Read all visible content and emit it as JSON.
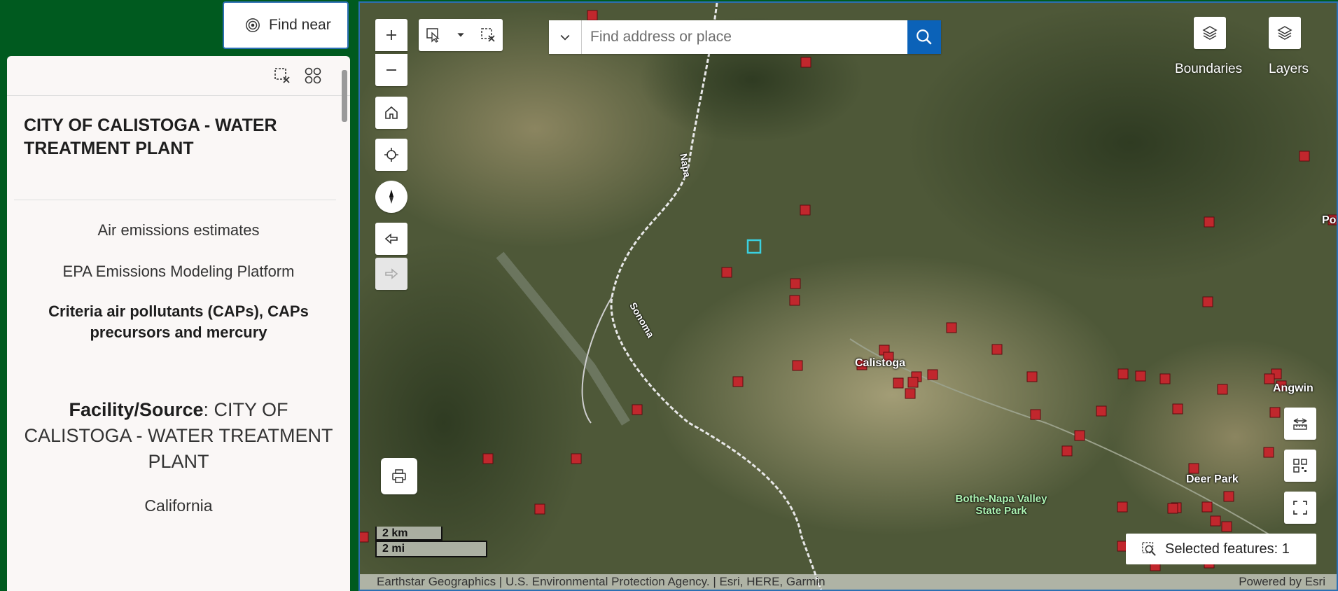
{
  "find_near": {
    "label": "Find near",
    "icon": "radar-icon"
  },
  "panel": {
    "title": "CITY OF CALISTOGA - WATER TREATMENT PLANT",
    "category": "Air emissions estimates",
    "source": "EPA Emissions Modeling Platform",
    "pollutants": "Criteria air pollutants (CAPs), CAPs precursors and mercury",
    "facility_label": "Facility/Source",
    "facility_value": ": CITY OF CALISTOGA - WATER TREATMENT PLANT",
    "state": "California"
  },
  "map": {
    "search_placeholder": "Find address or place",
    "boundaries_label": "Boundaries",
    "layers_label": "Layers",
    "scale_km": "2 km",
    "scale_mi": "2 mi",
    "selected_features": "Selected features: 1",
    "attribution": "Earthstar Geographics | U.S. Environmental Protection Agency. | Esri, HERE, Garmin",
    "powered_by": "Powered by Esri",
    "places": {
      "calistoga": "Calistoga",
      "angwin": "Angwin",
      "deer_park": "Deer Park",
      "po": "Po"
    },
    "park": "Bothe-Napa Valley State Park",
    "roads": {
      "napa": "Napa",
      "sonoma": "Sonoma"
    },
    "marker_color": "#c1272d",
    "selected_color": "#3ad0e0"
  }
}
